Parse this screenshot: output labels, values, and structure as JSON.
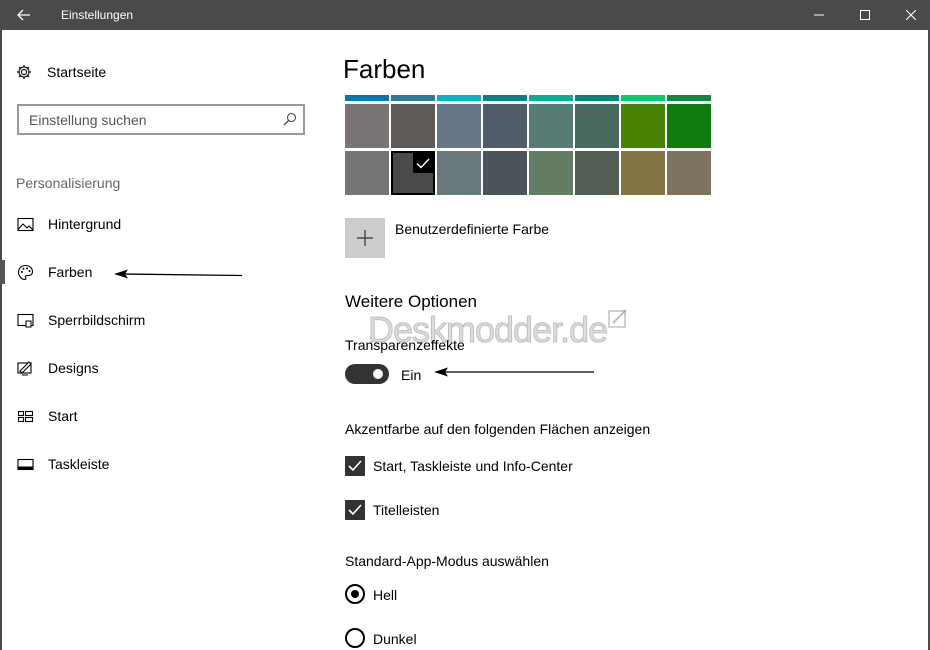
{
  "window": {
    "title": "Einstellungen"
  },
  "sidebar": {
    "home_label": "Startseite",
    "search_placeholder": "Einstellung suchen",
    "section_label": "Personalisierung",
    "items": [
      {
        "label": "Hintergrund",
        "icon": "image-icon",
        "selected": false
      },
      {
        "label": "Farben",
        "icon": "palette-icon",
        "selected": true
      },
      {
        "label": "Sperrbildschirm",
        "icon": "lock-screen-icon",
        "selected": false
      },
      {
        "label": "Designs",
        "icon": "themes-icon",
        "selected": false
      },
      {
        "label": "Start",
        "icon": "start-icon",
        "selected": false
      },
      {
        "label": "Taskleiste",
        "icon": "taskbar-icon",
        "selected": false
      }
    ]
  },
  "main": {
    "title": "Farben",
    "stripe_colors": [
      "#0078b4",
      "#2d7d9a",
      "#00b7c3",
      "#038387",
      "#00b294",
      "#018574",
      "#00cc6a",
      "#10893e"
    ],
    "swatch_rows": [
      [
        "#7a7574",
        "#5d5a58",
        "#68768a",
        "#515c6b",
        "#567c73",
        "#486860",
        "#498205",
        "#107c10"
      ],
      [
        "#767676",
        "#4c4a48",
        "#69797e",
        "#4a5459",
        "#647c64",
        "#525e54",
        "#847545",
        "#7e735f"
      ]
    ],
    "selected_swatch": {
      "row": 1,
      "col": 1
    },
    "custom_color_label": "Benutzerdefinierte Farbe",
    "more_options_heading": "Weitere Optionen",
    "transparency_label": "Transparenzeffekte",
    "transparency_state": "Ein",
    "accent_heading": "Akzentfarbe auf den folgenden Flächen anzeigen",
    "checkboxes": [
      {
        "label": "Start, Taskleiste und Info-Center",
        "checked": true
      },
      {
        "label": "Titelleisten",
        "checked": true
      }
    ],
    "app_mode_heading": "Standard-App-Modus auswählen",
    "radios": [
      {
        "label": "Hell",
        "selected": true
      },
      {
        "label": "Dunkel",
        "selected": false
      }
    ]
  },
  "watermark": "Deskmodder.de"
}
